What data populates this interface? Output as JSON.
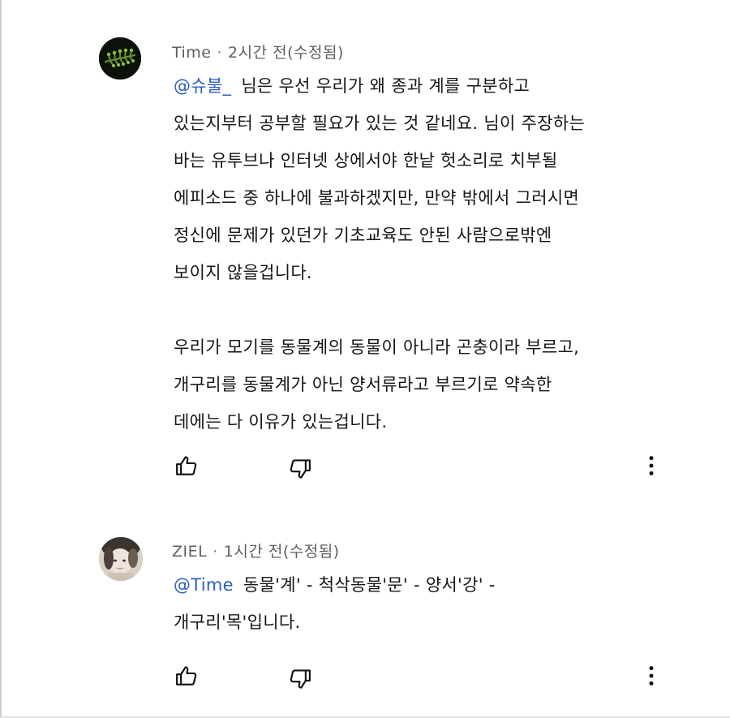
{
  "comments": [
    {
      "author": "Time",
      "separator": "·",
      "time": "2시간 전(수정됨)",
      "mention": "@슈불_",
      "text": "님은 우선 우리가 왜 종과 계를 구분하고\n있는지부터 공부할 필요가 있는 것 같네요.  님이 주장하는\n바는 유투브나 인터넷 상에서야 한낱  헛소리로 치부될\n에피소드 중 하나에 불과하겠지만, 만약 밖에서 그러시면\n정신에 문제가 있던가 기초교육도 안된 사람으로밖엔\n보이지 않을겁니다.\n\n우리가 모기를 동물계의 동물이 아니라 곤충이라 부르고,\n개구리를 동물계가 아닌 양서류라고 부르기로 약속한\n데에는 다 이유가 있는겁니다.",
      "avatar_icon": "green-foliage-avatar",
      "like_icon": "thumbs-up-icon",
      "dislike_icon": "thumbs-down-icon",
      "more_icon": "more-vertical-icon"
    },
    {
      "author": "ZIEL",
      "separator": "·",
      "time": "1시간 전(수정됨)",
      "mention": "@Time",
      "text": "동물'계' - 척삭동물'문' - 양서'강' -\n개구리'목'입니다.",
      "avatar_icon": "person-photo-avatar",
      "like_icon": "thumbs-up-icon",
      "dislike_icon": "thumbs-down-icon",
      "more_icon": "more-vertical-icon"
    }
  ],
  "colors": {
    "mention": "#2a5fbf",
    "meta": "#5f5f5f",
    "text": "#161616"
  }
}
